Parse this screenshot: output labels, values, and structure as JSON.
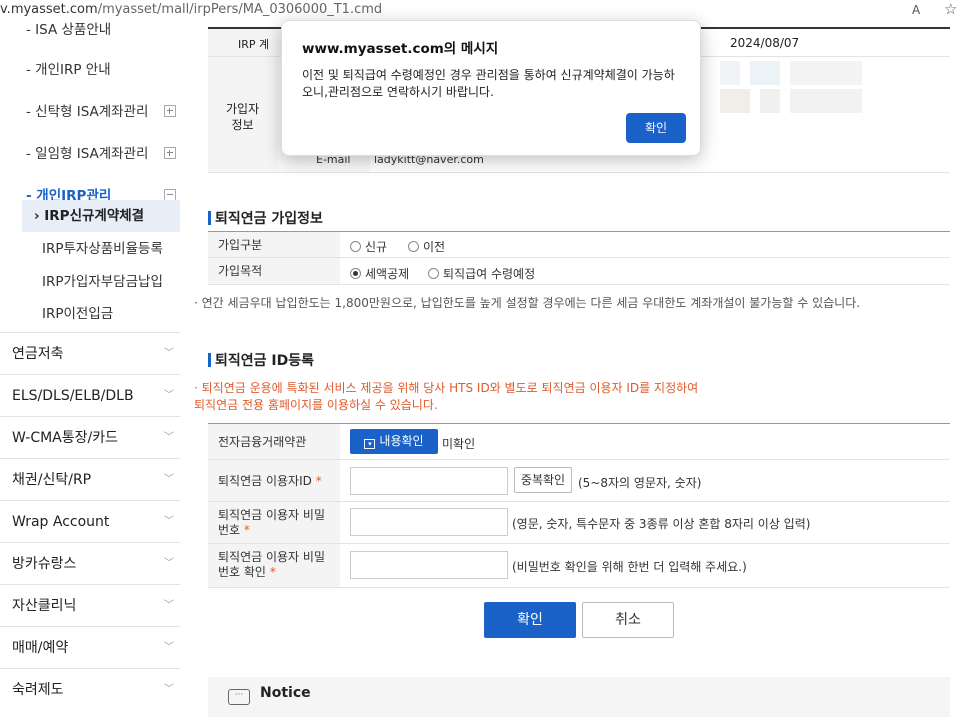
{
  "browser": {
    "url_prefix": "v.myasset.com",
    "url_rest": "/myasset/mall/irpPers/MA_0306000_T1.cmd",
    "reader_label": "A",
    "favorite_icon": "star-icon"
  },
  "sidebar": {
    "sub_items": [
      {
        "label": "- ISA 상품안내"
      },
      {
        "label": "- 개인IRP 안내"
      },
      {
        "label": "- 신탁형 ISA계좌관리"
      },
      {
        "label": "- 일임형 ISA계좌관리"
      },
      {
        "label": "- 개인IRP관리"
      }
    ],
    "leaf_items": [
      {
        "label": "› IRP신규계약체결"
      },
      {
        "label": "IRP투자상품비율등록"
      },
      {
        "label": "IRP가입자부담금납입"
      },
      {
        "label": "IRP이전입금"
      }
    ],
    "menus": [
      {
        "label": "연금저축"
      },
      {
        "label": "ELS/DLS/ELB/DLB"
      },
      {
        "label": "W-CMA통장/카드"
      },
      {
        "label": "채권/신탁/RP"
      },
      {
        "label": "Wrap Account"
      },
      {
        "label": "방카슈랑스"
      },
      {
        "label": "자산클리닉"
      },
      {
        "label": "매매/예약"
      },
      {
        "label": "숙려제도"
      }
    ]
  },
  "subscriber": {
    "irp_label": "IRP 계",
    "date": "2024/08/07",
    "group_label": "가입자\n정보",
    "email_label": "E-mail",
    "email": "ladykitt@naver.com"
  },
  "pension_info": {
    "title": "퇴직연금 가입정보",
    "type_label": "가입구분",
    "type_options": [
      "신규",
      "이전"
    ],
    "purpose_label": "가입목적",
    "purpose_options": [
      "세액공제",
      "퇴직급여 수령예정"
    ],
    "note": "· 연간 세금우대 납입한도는 1,800만원으로, 납입한도를 높게 설정할 경우에는 다른 세금 우대한도 계좌개설이 불가능할 수 있습니다."
  },
  "id_register": {
    "title": "퇴직연금 ID등록",
    "note": "· 퇴직연금 운용에 특화된 서비스 제공을 위해 당사 HTS ID와 별도로 퇴직연금 이용자 ID를 지정하여\n퇴직연금 전용 홈페이지를 이용하실 수 있습니다.",
    "terms_label": "전자금융거래약관",
    "terms_button": "내용확인",
    "terms_status": "미확인",
    "id_label": "퇴직연금 이용자ID",
    "dup_button": "중복확인",
    "id_hint": "(5~8자의 영문자, 숫자)",
    "pw_label": "퇴직연금 이용자 비밀번호",
    "pw_hint": "(영문, 숫자, 특수문자 중 3종류 이상 혼합 8자리 이상 입력)",
    "pw2_label": "퇴직연금 이용자 비밀번호 확인",
    "pw2_hint": "(비밀번호 확인을 위해 한번 더 입력해 주세요.)",
    "required_mark": "*",
    "confirm_button": "확인",
    "cancel_button": "취소"
  },
  "notice": {
    "title": "Notice"
  },
  "dialog": {
    "title": "www.myasset.com의 메시지",
    "message": "이전 및 퇴직급여 수령예정인 경우 관리점을 통하여 신규계약체결이 가능하오니,관리점으로 연락하시기 바랍니다.",
    "ok_label": "확인"
  },
  "colors": {
    "accent": "#1a62c8",
    "warning_text": "#e05a2b"
  }
}
